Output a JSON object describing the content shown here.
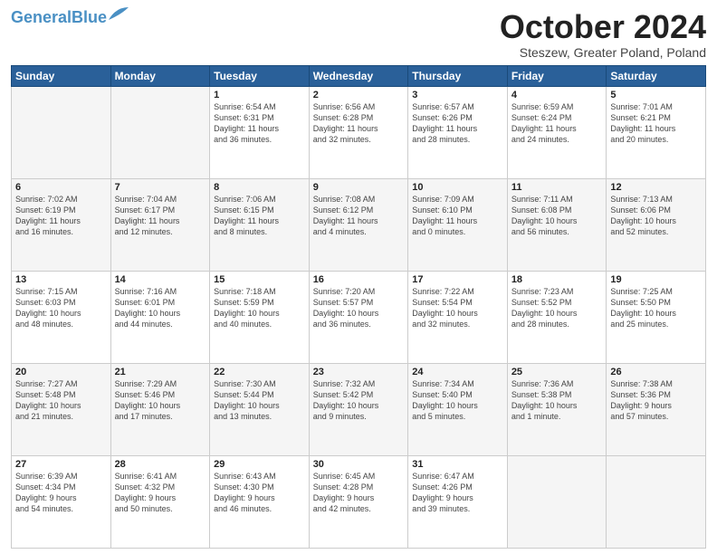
{
  "logo": {
    "line1": "General",
    "line2": "Blue"
  },
  "header": {
    "month": "October 2024",
    "location": "Steszew, Greater Poland, Poland"
  },
  "weekdays": [
    "Sunday",
    "Monday",
    "Tuesday",
    "Wednesday",
    "Thursday",
    "Friday",
    "Saturday"
  ],
  "weeks": [
    [
      {
        "day": "",
        "info": ""
      },
      {
        "day": "",
        "info": ""
      },
      {
        "day": "1",
        "info": "Sunrise: 6:54 AM\nSunset: 6:31 PM\nDaylight: 11 hours\nand 36 minutes."
      },
      {
        "day": "2",
        "info": "Sunrise: 6:56 AM\nSunset: 6:28 PM\nDaylight: 11 hours\nand 32 minutes."
      },
      {
        "day": "3",
        "info": "Sunrise: 6:57 AM\nSunset: 6:26 PM\nDaylight: 11 hours\nand 28 minutes."
      },
      {
        "day": "4",
        "info": "Sunrise: 6:59 AM\nSunset: 6:24 PM\nDaylight: 11 hours\nand 24 minutes."
      },
      {
        "day": "5",
        "info": "Sunrise: 7:01 AM\nSunset: 6:21 PM\nDaylight: 11 hours\nand 20 minutes."
      }
    ],
    [
      {
        "day": "6",
        "info": "Sunrise: 7:02 AM\nSunset: 6:19 PM\nDaylight: 11 hours\nand 16 minutes."
      },
      {
        "day": "7",
        "info": "Sunrise: 7:04 AM\nSunset: 6:17 PM\nDaylight: 11 hours\nand 12 minutes."
      },
      {
        "day": "8",
        "info": "Sunrise: 7:06 AM\nSunset: 6:15 PM\nDaylight: 11 hours\nand 8 minutes."
      },
      {
        "day": "9",
        "info": "Sunrise: 7:08 AM\nSunset: 6:12 PM\nDaylight: 11 hours\nand 4 minutes."
      },
      {
        "day": "10",
        "info": "Sunrise: 7:09 AM\nSunset: 6:10 PM\nDaylight: 11 hours\nand 0 minutes."
      },
      {
        "day": "11",
        "info": "Sunrise: 7:11 AM\nSunset: 6:08 PM\nDaylight: 10 hours\nand 56 minutes."
      },
      {
        "day": "12",
        "info": "Sunrise: 7:13 AM\nSunset: 6:06 PM\nDaylight: 10 hours\nand 52 minutes."
      }
    ],
    [
      {
        "day": "13",
        "info": "Sunrise: 7:15 AM\nSunset: 6:03 PM\nDaylight: 10 hours\nand 48 minutes."
      },
      {
        "day": "14",
        "info": "Sunrise: 7:16 AM\nSunset: 6:01 PM\nDaylight: 10 hours\nand 44 minutes."
      },
      {
        "day": "15",
        "info": "Sunrise: 7:18 AM\nSunset: 5:59 PM\nDaylight: 10 hours\nand 40 minutes."
      },
      {
        "day": "16",
        "info": "Sunrise: 7:20 AM\nSunset: 5:57 PM\nDaylight: 10 hours\nand 36 minutes."
      },
      {
        "day": "17",
        "info": "Sunrise: 7:22 AM\nSunset: 5:54 PM\nDaylight: 10 hours\nand 32 minutes."
      },
      {
        "day": "18",
        "info": "Sunrise: 7:23 AM\nSunset: 5:52 PM\nDaylight: 10 hours\nand 28 minutes."
      },
      {
        "day": "19",
        "info": "Sunrise: 7:25 AM\nSunset: 5:50 PM\nDaylight: 10 hours\nand 25 minutes."
      }
    ],
    [
      {
        "day": "20",
        "info": "Sunrise: 7:27 AM\nSunset: 5:48 PM\nDaylight: 10 hours\nand 21 minutes."
      },
      {
        "day": "21",
        "info": "Sunrise: 7:29 AM\nSunset: 5:46 PM\nDaylight: 10 hours\nand 17 minutes."
      },
      {
        "day": "22",
        "info": "Sunrise: 7:30 AM\nSunset: 5:44 PM\nDaylight: 10 hours\nand 13 minutes."
      },
      {
        "day": "23",
        "info": "Sunrise: 7:32 AM\nSunset: 5:42 PM\nDaylight: 10 hours\nand 9 minutes."
      },
      {
        "day": "24",
        "info": "Sunrise: 7:34 AM\nSunset: 5:40 PM\nDaylight: 10 hours\nand 5 minutes."
      },
      {
        "day": "25",
        "info": "Sunrise: 7:36 AM\nSunset: 5:38 PM\nDaylight: 10 hours\nand 1 minute."
      },
      {
        "day": "26",
        "info": "Sunrise: 7:38 AM\nSunset: 5:36 PM\nDaylight: 9 hours\nand 57 minutes."
      }
    ],
    [
      {
        "day": "27",
        "info": "Sunrise: 6:39 AM\nSunset: 4:34 PM\nDaylight: 9 hours\nand 54 minutes."
      },
      {
        "day": "28",
        "info": "Sunrise: 6:41 AM\nSunset: 4:32 PM\nDaylight: 9 hours\nand 50 minutes."
      },
      {
        "day": "29",
        "info": "Sunrise: 6:43 AM\nSunset: 4:30 PM\nDaylight: 9 hours\nand 46 minutes."
      },
      {
        "day": "30",
        "info": "Sunrise: 6:45 AM\nSunset: 4:28 PM\nDaylight: 9 hours\nand 42 minutes."
      },
      {
        "day": "31",
        "info": "Sunrise: 6:47 AM\nSunset: 4:26 PM\nDaylight: 9 hours\nand 39 minutes."
      },
      {
        "day": "",
        "info": ""
      },
      {
        "day": "",
        "info": ""
      }
    ]
  ]
}
